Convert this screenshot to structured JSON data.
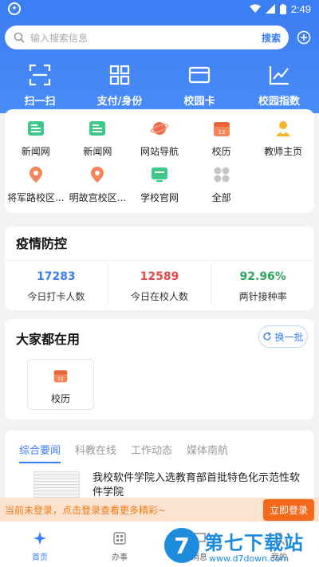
{
  "status_bar": {
    "time": "2:49"
  },
  "search": {
    "placeholder": "输入搜索信息",
    "button": "搜索"
  },
  "quick_actions": [
    {
      "label": "扫一扫",
      "icon": "scan-icon"
    },
    {
      "label": "支付/身份",
      "icon": "qr-code-icon"
    },
    {
      "label": "校园卡",
      "icon": "card-icon"
    },
    {
      "label": "校园指数",
      "icon": "chart-line-icon"
    }
  ],
  "apps": [
    {
      "label": "新闻网",
      "icon": "news-icon",
      "color": "#3ec98a"
    },
    {
      "label": "新闻网",
      "icon": "news-icon",
      "color": "#3ec98a"
    },
    {
      "label": "网站导航",
      "icon": "planet-icon",
      "color": "#f06a4a"
    },
    {
      "label": "校历",
      "icon": "calendar-icon",
      "color": "#f4845a"
    },
    {
      "label": "教师主页",
      "icon": "teacher-icon",
      "color": "#f5b72a"
    },
    {
      "label": "将军路校区...",
      "icon": "location-pin-icon",
      "color": "#f4845a"
    },
    {
      "label": "明故宫校区...",
      "icon": "location-pin-icon",
      "color": "#f4845a"
    },
    {
      "label": "学校官网",
      "icon": "monitor-icon",
      "color": "#3ec98a"
    },
    {
      "label": "全部",
      "icon": "grid-all-icon",
      "color": "#c6c6c6"
    }
  ],
  "covid": {
    "title": "疫情防控",
    "stats": [
      {
        "value": "17283",
        "label": "今日打卡人数",
        "color": "#3c7ef3"
      },
      {
        "value": "12589",
        "label": "今日在校人数",
        "color": "#e24a4a"
      },
      {
        "value": "92.96%",
        "label": "两针接种率",
        "color": "#2da65a"
      }
    ]
  },
  "popular": {
    "title": "大家都在用",
    "refresh": "换一批",
    "items": [
      {
        "label": "校历",
        "icon": "calendar-icon"
      }
    ]
  },
  "news": {
    "tabs": [
      "综合要闻",
      "科教在线",
      "工作动态",
      "媒体南航"
    ],
    "active_tab": 0,
    "items": [
      {
        "title": "我校软件学院入选教育部首批特色化示范性软件学院"
      }
    ]
  },
  "login_banner": {
    "text": "当前未登录，点击登录查看更多精彩~",
    "button": "立即登录"
  },
  "bottom_nav": [
    {
      "label": "首页",
      "icon": "home-plane-icon",
      "active": true
    },
    {
      "label": "办事",
      "icon": "apps-icon",
      "active": false
    },
    {
      "label": "消息",
      "icon": "message-icon",
      "active": false
    },
    {
      "label": "我的",
      "icon": "user-icon",
      "active": false
    }
  ],
  "watermark": {
    "brand": "第七下载站",
    "url": "www.d7down.com",
    "logo_digit": "7"
  },
  "colors": {
    "primary": "#3c7ef3",
    "orange": "#f36a1d",
    "banner_bg": "#fbe3cf"
  }
}
